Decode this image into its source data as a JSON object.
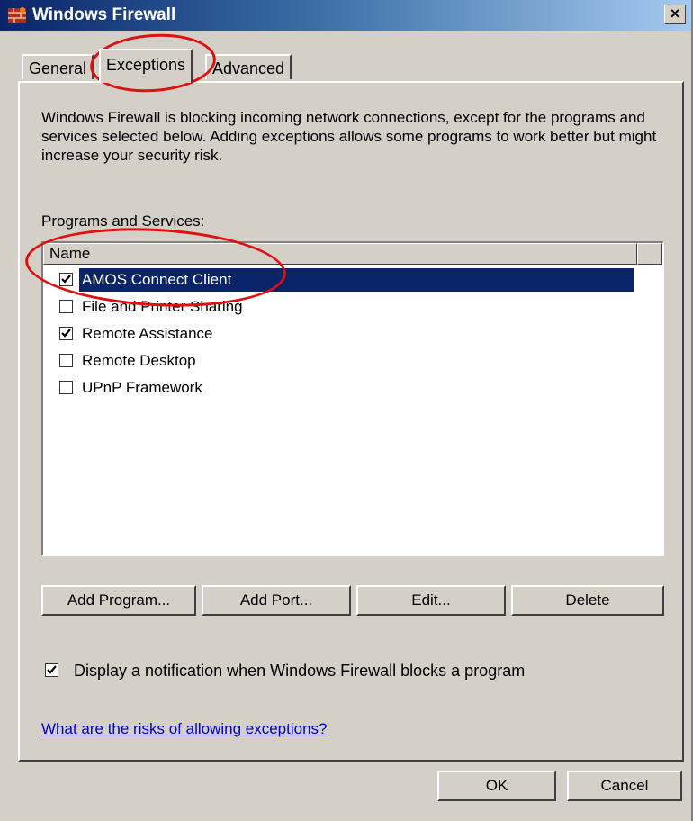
{
  "window": {
    "title": "Windows Firewall",
    "close_glyph": "×"
  },
  "tabs": [
    {
      "label": "General",
      "active": false
    },
    {
      "label": "Exceptions",
      "active": true
    },
    {
      "label": "Advanced",
      "active": false
    }
  ],
  "description": "Windows Firewall is blocking incoming network connections, except for the programs and services selected below. Adding exceptions allows some programs to work better but might increase your security risk.",
  "programs": {
    "group_label": "Programs and Services:",
    "column_name": "Name",
    "items": [
      {
        "label": "AMOS Connect Client",
        "checked": true,
        "selected": true
      },
      {
        "label": "File and Printer Sharing",
        "checked": false,
        "selected": false
      },
      {
        "label": "Remote Assistance",
        "checked": true,
        "selected": false
      },
      {
        "label": "Remote Desktop",
        "checked": false,
        "selected": false
      },
      {
        "label": "UPnP Framework",
        "checked": false,
        "selected": false
      }
    ]
  },
  "actions": {
    "add_program": "Add Program...",
    "add_port": "Add Port...",
    "edit": "Edit...",
    "delete": "Delete"
  },
  "notification": {
    "label": "Display a notification when Windows Firewall blocks a program",
    "checked": true
  },
  "risk_link": "What are the risks of allowing exceptions?",
  "footer": {
    "ok": "OK",
    "cancel": "Cancel"
  },
  "colors": {
    "title_bar": "#0a246a",
    "selection": "#0a246a",
    "annotation": "#e01010"
  }
}
